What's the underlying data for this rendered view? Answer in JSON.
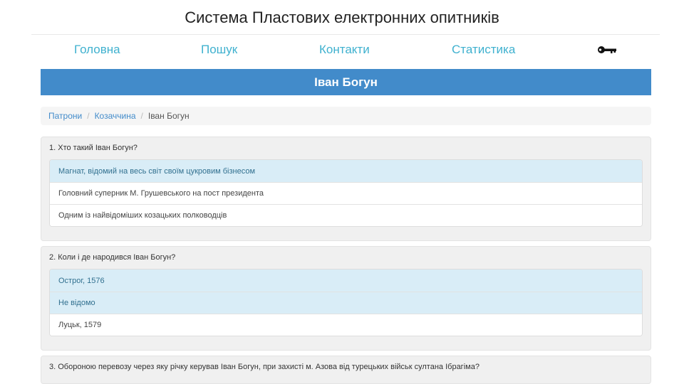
{
  "header": {
    "title": "Система Пластових електронних опитників"
  },
  "nav": {
    "items": [
      {
        "label": "Головна"
      },
      {
        "label": "Пошук"
      },
      {
        "label": "Контакти"
      },
      {
        "label": "Статистика"
      }
    ],
    "login_icon": "key-icon"
  },
  "page": {
    "title": "Іван Богун"
  },
  "breadcrumb": {
    "items": [
      {
        "label": "Патрони"
      },
      {
        "label": "Козаччина"
      }
    ],
    "current": "Іван Богун"
  },
  "questions": [
    {
      "text": "1. Хто такий Іван Богун?",
      "answers": [
        {
          "label": "Магнат, відомий на весь світ своїм цукровим бізнесом",
          "selected": true
        },
        {
          "label": "Головний суперник М. Грушевського на пост президента",
          "selected": false
        },
        {
          "label": "Одним із найвідоміших козацьких полководців",
          "selected": false
        }
      ]
    },
    {
      "text": "2. Коли і де народився Іван Богун?",
      "answers": [
        {
          "label": "Острог, 1576",
          "selected": true
        },
        {
          "label": "Не відомо",
          "selected": true
        },
        {
          "label": "Луцьк, 1579",
          "selected": false
        }
      ]
    },
    {
      "text": "3. Обороною перевозу через яку річку керував Іван Богун, при захисті м. Азова від турецьких військ султана Ібрагіма?",
      "answers": []
    }
  ],
  "colors": {
    "accent": "#428bca",
    "nav_link": "#3fb1cf",
    "selected_bg": "#d9edf7"
  }
}
